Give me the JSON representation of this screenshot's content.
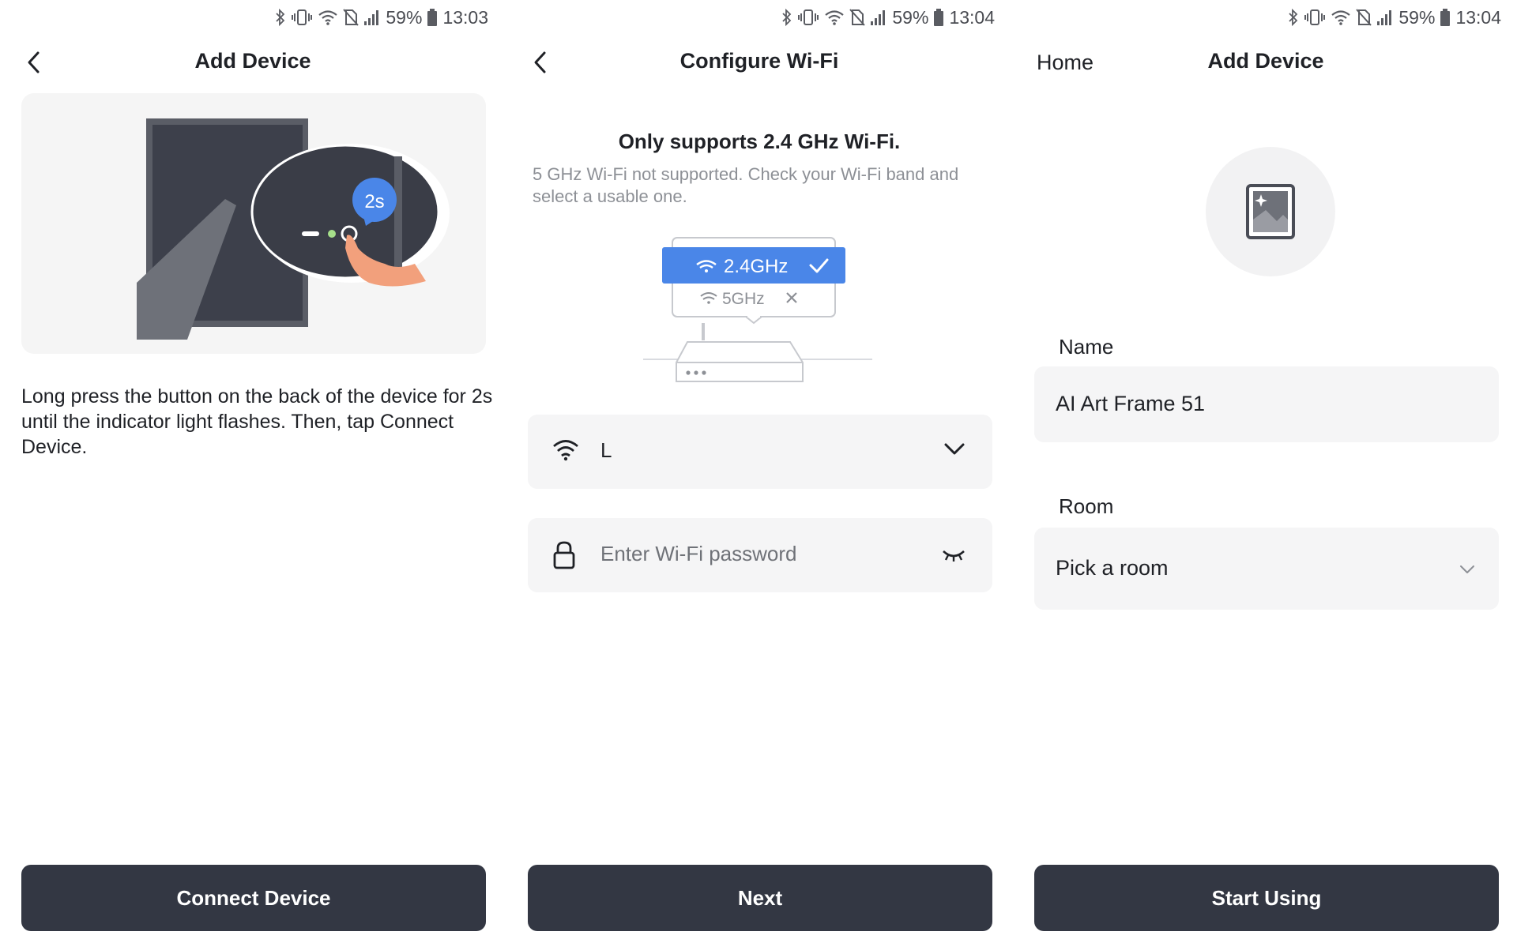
{
  "status_bars": [
    {
      "battery": "59%",
      "time": "13:03"
    },
    {
      "battery": "59%",
      "time": "13:04"
    },
    {
      "battery": "59%",
      "time": "13:04"
    }
  ],
  "screen1": {
    "title": "Add Device",
    "timer_badge": "2s",
    "instruction": "Long press the button on the back of the device for 2s until the indicator light flashes. Then, tap Connect Device.",
    "button": "Connect Device"
  },
  "screen2": {
    "title": "Configure Wi-Fi",
    "warning_title": "Only supports 2.4 GHz Wi-Fi.",
    "warning_sub": "5 GHz Wi-Fi not supported. Check your Wi-Fi band and select a usable one.",
    "band_supported": "2.4GHz",
    "band_unsupported": "5GHz",
    "ssid": "L",
    "password_placeholder": "Enter Wi-Fi password",
    "button": "Next"
  },
  "screen3": {
    "home_link": "Home",
    "title": "Add Device",
    "name_label": "Name",
    "name_value": "AI Art Frame 51",
    "room_label": "Room",
    "room_placeholder": "Pick a room",
    "button": "Start Using"
  },
  "icons": {
    "status": [
      "bluetooth-icon",
      "vibrate-icon",
      "wifi-icon",
      "no-sim-icon",
      "signal-icon",
      "battery-icon"
    ],
    "back": "chevron-left-icon",
    "wifi_field": "wifi-icon",
    "password_field": "lock-icon",
    "password_toggle": "eye-closed-icon",
    "dropdown": "chevron-down-icon",
    "device_avatar": "picture-frame-icon"
  },
  "colors": {
    "primary_button": "#333743",
    "accent_blue": "#4a86e8",
    "field_bg": "#f5f5f6",
    "secondary_text": "#8d9096"
  }
}
